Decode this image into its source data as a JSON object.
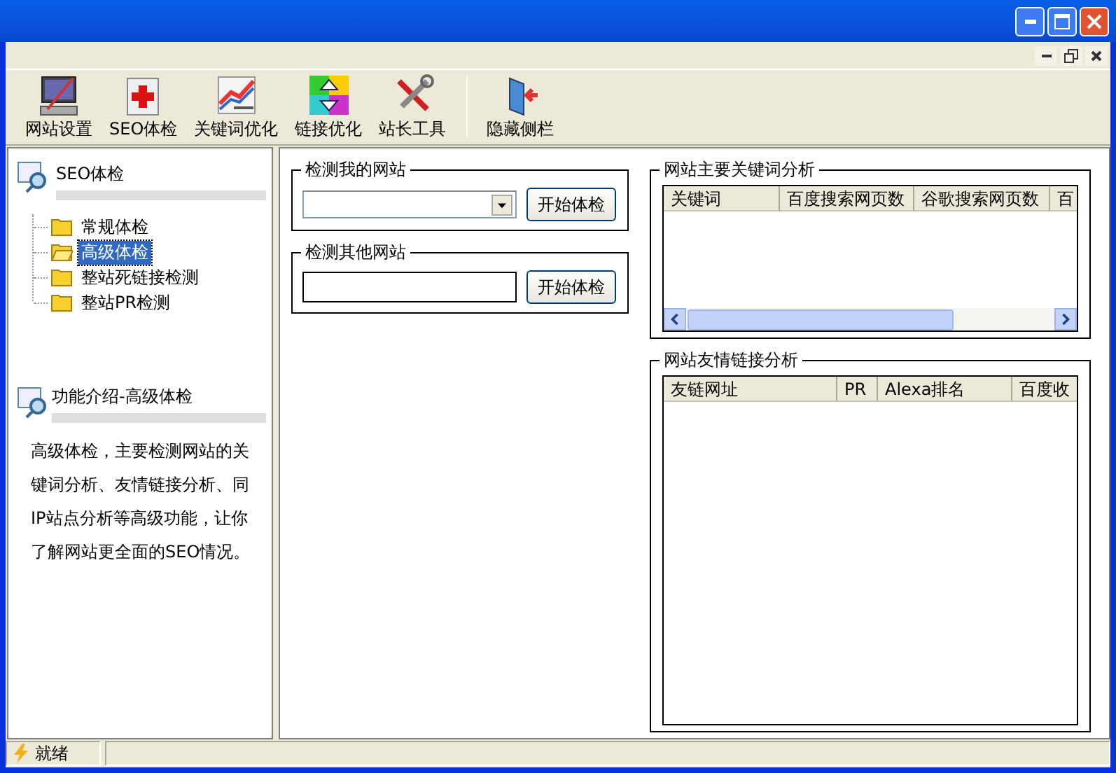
{
  "toolbar": [
    {
      "label": "网站设置"
    },
    {
      "label": "SEO体检"
    },
    {
      "label": "关键词优化"
    },
    {
      "label": "链接优化"
    },
    {
      "label": "站长工具"
    },
    {
      "label": "隐藏侧栏"
    }
  ],
  "sidebar": {
    "tree": {
      "title": "SEO体检",
      "items": [
        {
          "label": "常规体检",
          "selected": false
        },
        {
          "label": "高级体检",
          "selected": true
        },
        {
          "label": "整站死链接检测",
          "selected": false
        },
        {
          "label": "整站PR检测",
          "selected": false
        }
      ]
    },
    "info": {
      "title": "功能介绍-高级体检",
      "text": "高级体检，主要检测网站的关键词分析、友情链接分析、同IP站点分析等高级功能，让你了解网站更全面的SEO情况。"
    }
  },
  "my_site": {
    "title": "检测我的网站",
    "button": "开始体检"
  },
  "other_site": {
    "title": "检测其他网站",
    "button": "开始体检"
  },
  "keyword_table": {
    "title": "网站主要关键词分析",
    "columns": [
      "关键词",
      "百度搜索网页数",
      "谷歌搜索网页数",
      "百"
    ]
  },
  "link_table": {
    "title": "网站友情链接分析",
    "columns": [
      "友链网址",
      "PR",
      "Alexa排名",
      "百度收"
    ]
  },
  "status_bar": {
    "text": "就绪"
  }
}
